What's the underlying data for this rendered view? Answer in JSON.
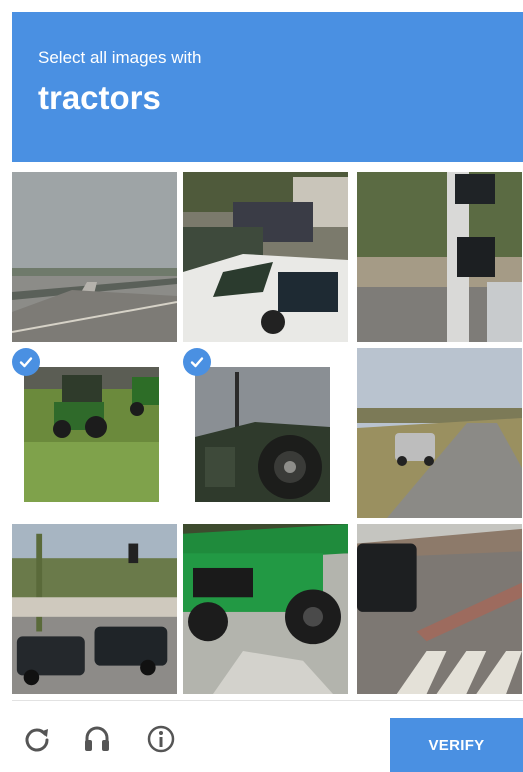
{
  "header": {
    "instruction": "Select all images with",
    "target": "tractors",
    "accent_color": "#4a90e2"
  },
  "grid": {
    "tiles": [
      {
        "row": 1,
        "col": 1,
        "scene": "highway-overpass",
        "selected": false
      },
      {
        "row": 1,
        "col": 2,
        "scene": "white-pickup-trucks",
        "selected": false
      },
      {
        "row": 1,
        "col": 3,
        "scene": "traffic-signal-pole",
        "selected": false
      },
      {
        "row": 2,
        "col": 1,
        "scene": "green-tractors-on-grass",
        "selected": true
      },
      {
        "row": 2,
        "col": 2,
        "scene": "tractor-wheel-closeup",
        "selected": true
      },
      {
        "row": 2,
        "col": 3,
        "scene": "car-on-rural-road",
        "selected": false
      },
      {
        "row": 3,
        "col": 1,
        "scene": "intersection-with-cars",
        "selected": false
      },
      {
        "row": 3,
        "col": 2,
        "scene": "green-telehandler",
        "selected": false
      },
      {
        "row": 3,
        "col": 3,
        "scene": "crosswalk-with-car",
        "selected": false
      }
    ]
  },
  "footer": {
    "icons": [
      "reload-icon",
      "headphones-icon",
      "info-icon"
    ],
    "verify_label": "VERIFY"
  }
}
